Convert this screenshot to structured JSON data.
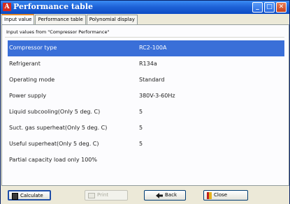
{
  "window": {
    "title": "Performance table",
    "app_icon_letter": "A"
  },
  "tabs": [
    {
      "label": "Input value",
      "active": true
    },
    {
      "label": "Performance table",
      "active": false
    },
    {
      "label": "Polynomial display",
      "active": false
    }
  ],
  "panel": {
    "section_label": "Input values from \"Compressor Performance\"",
    "rows": [
      {
        "label": "Compressor type",
        "value": "RC2-100A",
        "selected": true
      },
      {
        "label": "Refrigerant",
        "value": "R134a",
        "selected": false
      },
      {
        "label": "Operating mode",
        "value": "Standard",
        "selected": false
      },
      {
        "label": "Power supply",
        "value": "380V-3-60Hz",
        "selected": false
      },
      {
        "label": "Liquid subcooling(Only 5 deg. C)",
        "value": "5",
        "selected": false
      },
      {
        "label": "Suct. gas superheat(Only 5 deg. C)",
        "value": "5",
        "selected": false
      },
      {
        "label": "Useful superheat(Only 5 deg. C)",
        "value": "5",
        "selected": false
      },
      {
        "label": "Partial capacity load only 100%",
        "value": "",
        "selected": false
      }
    ]
  },
  "footer": {
    "calculate_label": "Calculate",
    "print_label": "Print",
    "back_label": "Back",
    "close_label": "Close"
  },
  "colors": {
    "selection": "#3a6fd8",
    "title_bar": "#1f63d8",
    "active_tab_accent": "#e68b2c"
  }
}
